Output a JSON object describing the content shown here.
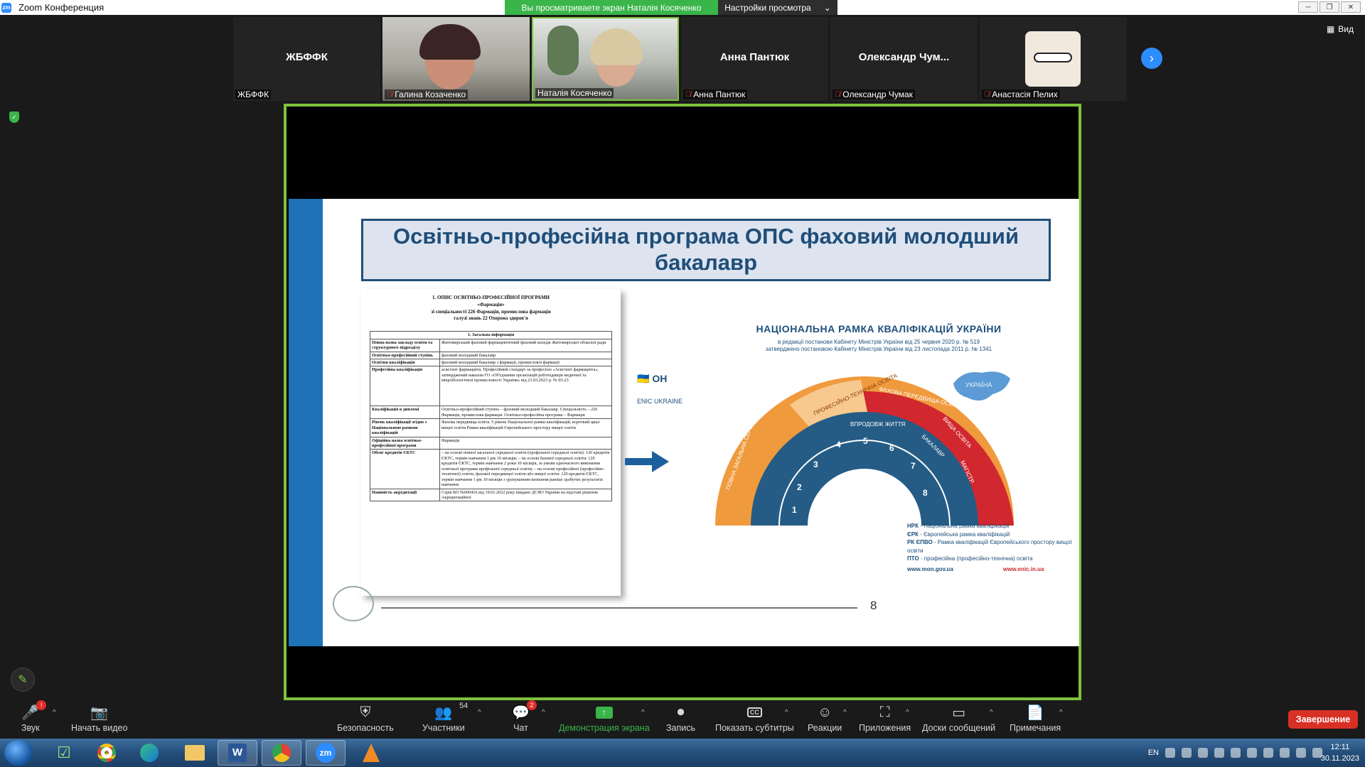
{
  "window": {
    "title": "Zoom Конференция",
    "share_banner": "Вы просматриваете экран Наталія Косяченко",
    "view_options": "Настройки просмотра"
  },
  "participants": [
    {
      "name": "ЖБФФК",
      "display": "ЖБФФК",
      "video": false,
      "muted": false
    },
    {
      "name": "Галина Козаченко",
      "video": true,
      "muted": true
    },
    {
      "name": "Наталія Косяченко",
      "video": true,
      "muted": false,
      "active_speaker": true
    },
    {
      "name": "Анна Пантюк",
      "display": "Анна Пантюк",
      "video": false,
      "muted": true
    },
    {
      "name": "Олександр Чумак",
      "display": "Олександр Чум...",
      "video": false,
      "muted": true
    },
    {
      "name": "Анастасія Пелих",
      "video": true,
      "muted": true
    }
  ],
  "view_button": "Вид",
  "slide": {
    "title": "Освітньо-професійна програма ОПС фаховий молодший бакалавр",
    "page_number": "8",
    "doc": {
      "heading_lines": [
        "1. ОПИС ОСВІТНЬО-ПРОФЕСІЙНОЇ ПРОГРАМИ",
        "«Фармація»",
        "зі спеціальності 226 Фармація, промислова фармація",
        "галузі знань 22 Охорона здоров'я"
      ],
      "section": "1. Загальна інформація",
      "rows": [
        {
          "k": "Повна назва закладу освіти та структурного підрозділу",
          "v": "Житомирський фаховий фармацевтичний фаховий коледж Житомирської обласної ради"
        },
        {
          "k": "Освітньо-професійний ступінь",
          "v": "фаховий молодший бакалавр"
        },
        {
          "k": "Освітня кваліфікація",
          "v": "фаховий молодший бакалавр з фармації, промислової фармації"
        },
        {
          "k": "Професійна кваліфікація",
          "v": "асистент фармацевта. Професійний стандарт за професією «Асистент фармацевта», затверджений наказом ГО «Об'єднання організацій роботодавців медичної та мікробіологічної промисловості України» від 23.03.2023 р. № 03-23"
        },
        {
          "k": "Кваліфікація в дипломі",
          "v": "Освітньо-професійний ступінь – фаховий молодший бакалавр. Спеціальність – 226 Фармація, промислова фармація. Освітньо-професійна програма – Фармація"
        },
        {
          "k": "Рівень кваліфікації згідно з Національною рамкою кваліфікацій",
          "v": "Фахова передвища освіта. 5 рівень Національної рамки кваліфікацій, короткий цикл вищої освіти Рамки кваліфікацій Європейського простору вищої освіти"
        },
        {
          "k": "Офіційна назва освітньо-професійної програми",
          "v": "Фармація"
        },
        {
          "k": "Обсяг кредитів ЄКТС",
          "v": "– на основі повної загальної середньої освіти (профільної середньої освіти): 120 кредитів ЄКТС, термін навчання 1 рік 10 місяців; – на основі базової середньої освіти: 120 кредитів ЄКТС, термін навчання 2 роки 10 місяців, за умови одночасного виконання освітньої програми профільної середньої освіти; – на основі професійної (професійно-технічної) освіти, фахової передвищої освіти або вищої освіти: 120 кредитів ЄКТС, термін навчання 1 рік 10 місяців з урахуванням визнання раніше здобутих результатів навчання"
        },
        {
          "k": "Наявність акредитації",
          "v": "Серія КО №000416 від 19.01.2022 року (видано ДСЯО України на підставі рішення Акредитаційної"
        }
      ]
    },
    "nrk": {
      "title": "НАЦІОНАЛЬНА РАМКА КВАЛІФІКАЦІЙ УКРАЇНИ",
      "sub1": "в редакції постанови Кабінету Міністрів України від 25 червня 2020 р. № 519",
      "sub2": "затверджено постановою Кабінету Міністрів України від 23 листопада 2011 р. № 1341",
      "country": "УКРАЇНА",
      "legend": [
        {
          "abbr": "НРК",
          "text": " - Національна рамка кваліфікацій"
        },
        {
          "abbr": "ЄРК",
          "text": " - Європейська рамка кваліфікацій"
        },
        {
          "abbr": "РК ЄПВО",
          "text": " - Рамка кваліфікацій Європейського простору вищої освіти"
        },
        {
          "abbr": "ПТО",
          "text": " - професійна (професійно-технічна) освіта"
        }
      ],
      "site1": "www.mon.gov.ua",
      "site2": "www.enic.in.ua",
      "enic": "ENIC UKRAINE",
      "arc_labels": [
        "ПОВНА ЗАГАЛЬНА СЕРЕДНЯ ОСВІТА",
        "ПРОФЕСІЙНО-ТЕХНІЧНА ОСВІТА",
        "ФАХОВА ПЕРЕДВИЩА ОСВІТА",
        "ВИЩА ОСВІТА",
        "ВПРОДОВЖ ЖИТТЯ",
        "БАКАЛАВР",
        "МАГІСТР"
      ],
      "levels": [
        "1",
        "2",
        "3",
        "4",
        "5",
        "6",
        "7",
        "8"
      ]
    }
  },
  "toolbar": {
    "audio": "Звук",
    "video": "Начать видео",
    "security": "Безопасность",
    "participants": "Участники",
    "participants_count": "54",
    "chat": "Чат",
    "chat_badge": "2",
    "share": "Демонстрация экрана",
    "record": "Запись",
    "captions": "Показать субтитры",
    "reactions": "Реакции",
    "apps": "Приложения",
    "whiteboards": "Доски сообщений",
    "notes": "Примечания",
    "end": "Завершение",
    "audio_badge": "!"
  },
  "taskbar": {
    "lang": "EN",
    "time": "12:11",
    "date": "30.11.2023",
    "apps": [
      "tasks",
      "chrome",
      "edge",
      "explorer",
      "word",
      "chrome-profile",
      "zoom",
      "vlc"
    ],
    "zoom_label": "zm",
    "word_label": "W"
  },
  "colors": {
    "share_green": "#3ab54a",
    "frame_green": "#7ec23c",
    "zoom_blue": "#2d8cff",
    "end_red": "#d93025",
    "title_navy": "#1f4e79"
  }
}
